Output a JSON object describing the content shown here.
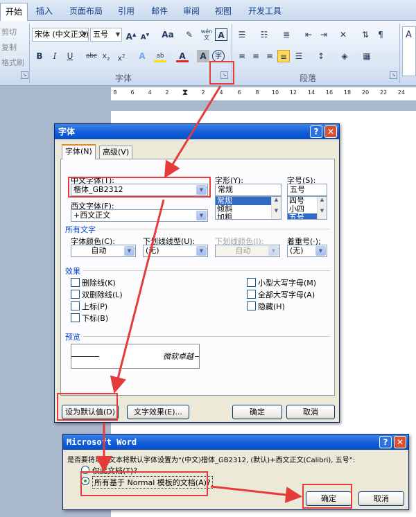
{
  "ribbon": {
    "tabs": [
      "开始",
      "插入",
      "页面布局",
      "引用",
      "邮件",
      "审阅",
      "视图",
      "开发工具"
    ],
    "clipboard": [
      "剪切",
      "复制",
      "格式刷"
    ],
    "font_name": "宋体 (中文正文)",
    "font_size": "五号",
    "group_font": "字体",
    "group_paragraph": "段落",
    "aa_label": "Aa",
    "wen_label": "wén",
    "ruler_ticks": [
      "8",
      "6",
      "4",
      "2",
      "2",
      "4",
      "6",
      "8",
      "10",
      "12",
      "14",
      "16",
      "18",
      "20",
      "22",
      "24"
    ]
  },
  "font_dialog": {
    "title": "字体",
    "tabs": [
      "字体(N)",
      "高级(V)"
    ],
    "chinese_font_label": "中文字体(T):",
    "chinese_font_value": "楷体_GB2312",
    "western_font_label": "西文字体(F):",
    "western_font_value": "+西文正文",
    "style_label": "字形(Y):",
    "style_value": "常规",
    "style_options": [
      "常规",
      "倾斜",
      "加粗"
    ],
    "size_label": "字号(S):",
    "size_value": "五号",
    "size_options": [
      "四号",
      "小四",
      "五号"
    ],
    "all_text_section": "所有文字",
    "font_color_label": "字体颜色(C):",
    "font_color_value": "自动",
    "underline_label": "下划线线型(U):",
    "underline_value": "(无)",
    "underline_color_label": "下划线颜色(I):",
    "underline_color_value": "自动",
    "emphasis_label": "着重号(·);",
    "emphasis_value": "(无)",
    "effects_section": "效果",
    "effects_left": [
      "删除线(K)",
      "双删除线(L)",
      "上标(P)",
      "下标(B)"
    ],
    "effects_right": [
      "小型大写字母(M)",
      "全部大写字母(A)",
      "隐藏(H)"
    ],
    "preview_section": "预览",
    "preview_text": "微软卓越",
    "set_default_button": "设为默认值(D)",
    "text_effects_button": "文字效果(E)...",
    "ok_button": "确定",
    "cancel_button": "取消"
  },
  "word_dialog": {
    "title": "Microsoft Word",
    "message": "是否要将以此文本将默认字体设置为“(中文)楷体_GB2312, (默认)+西文正文(Calibri), 五号”:",
    "option_this_doc": "仅此文档(T)?",
    "option_all_docs": "所有基于 Normal 模板的文档(A)?",
    "ok_button": "确定",
    "cancel_button": "取消"
  },
  "colors": {
    "annotation_red": "#e53b3b",
    "titlebar_blue": "#0f5bd8",
    "section_blue": "#0046d5",
    "selection_blue": "#316ac5"
  }
}
